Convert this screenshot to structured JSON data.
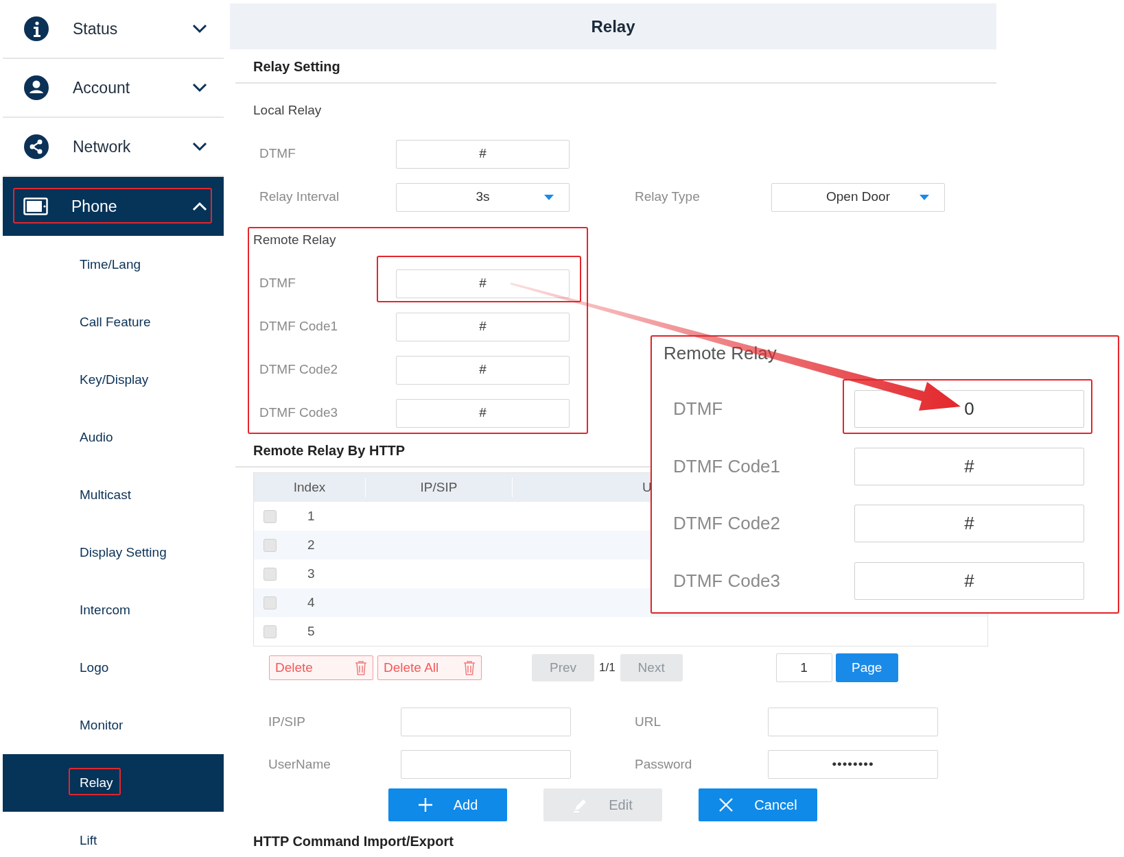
{
  "sidebar": {
    "items": [
      {
        "label": "Status",
        "expanded": false,
        "selected": false,
        "annotated": false
      },
      {
        "label": "Account",
        "expanded": false,
        "selected": false,
        "annotated": false
      },
      {
        "label": "Network",
        "expanded": false,
        "selected": false,
        "annotated": false
      },
      {
        "label": "Phone",
        "expanded": true,
        "selected": true,
        "annotated": true,
        "children": [
          {
            "label": "Time/Lang",
            "selected": false,
            "annotated": false
          },
          {
            "label": "Call Feature",
            "selected": false,
            "annotated": false
          },
          {
            "label": "Key/Display",
            "selected": false,
            "annotated": false
          },
          {
            "label": "Audio",
            "selected": false,
            "annotated": false
          },
          {
            "label": "Multicast",
            "selected": false,
            "annotated": false
          },
          {
            "label": "Display Setting",
            "selected": false,
            "annotated": false
          },
          {
            "label": "Intercom",
            "selected": false,
            "annotated": false
          },
          {
            "label": "Logo",
            "selected": false,
            "annotated": false
          },
          {
            "label": "Monitor",
            "selected": false,
            "annotated": false
          },
          {
            "label": "Relay",
            "selected": true,
            "annotated": true
          },
          {
            "label": "Lift",
            "selected": false,
            "annotated": false
          }
        ]
      }
    ]
  },
  "page_title": "Relay",
  "relay_setting": {
    "heading": "Relay Setting",
    "local_relay": {
      "heading": "Local Relay",
      "rows": [
        [
          {
            "kind": "input",
            "label": "DTMF",
            "value": "#"
          }
        ],
        [
          {
            "kind": "select",
            "label": "Relay Interval",
            "value": "3s"
          },
          {
            "kind": "select",
            "label": "Relay Type",
            "value": "Open Door"
          }
        ]
      ]
    },
    "remote_relay": {
      "heading": "Remote Relay",
      "annotated": true,
      "fields": [
        {
          "kind": "input",
          "label": "DTMF",
          "value": "#",
          "annotated": true
        },
        {
          "kind": "input",
          "label": "DTMF Code1",
          "value": "#",
          "annotated": false
        },
        {
          "kind": "input",
          "label": "DTMF Code2",
          "value": "#",
          "annotated": false
        },
        {
          "kind": "input",
          "label": "DTMF Code3",
          "value": "#",
          "annotated": false
        }
      ]
    }
  },
  "http": {
    "heading": "Remote Relay By HTTP",
    "table": {
      "columns": [
        "Index",
        "IP/SIP",
        "U"
      ],
      "rows": [
        {
          "index": "1",
          "checked": false
        },
        {
          "index": "2",
          "checked": false
        },
        {
          "index": "3",
          "checked": false
        },
        {
          "index": "4",
          "checked": false
        },
        {
          "index": "5",
          "checked": false
        }
      ]
    },
    "delete_buttons": [
      {
        "label": "Delete"
      },
      {
        "label": "Delete All"
      }
    ],
    "pager": {
      "prev": {
        "label": "Prev",
        "disabled": true
      },
      "position": "1/1",
      "next": {
        "label": "Next",
        "disabled": true
      },
      "page_input": "1",
      "page_button": "Page"
    },
    "form_rows": [
      [
        {
          "kind": "input",
          "label": "IP/SIP"
        },
        {
          "kind": "input",
          "label": "URL"
        }
      ],
      [
        {
          "kind": "input",
          "label": "UserName"
        },
        {
          "kind": "password",
          "label": "Password",
          "value": "••••••••"
        }
      ]
    ],
    "buttons": [
      {
        "label": "Add",
        "disabled": false
      },
      {
        "label": "Edit",
        "disabled": true
      },
      {
        "label": "Cancel",
        "disabled": false
      }
    ]
  },
  "import_export": {
    "heading": "HTTP Command Import/Export"
  },
  "zoom_inset": {
    "heading": "Remote Relay",
    "fields": [
      {
        "label": "DTMF",
        "value": "0",
        "annotated": true
      },
      {
        "label": "DTMF Code1",
        "value": "#",
        "annotated": false
      },
      {
        "label": "DTMF Code2",
        "value": "#",
        "annotated": false
      },
      {
        "label": "DTMF Code3",
        "value": "#",
        "annotated": false
      }
    ]
  }
}
